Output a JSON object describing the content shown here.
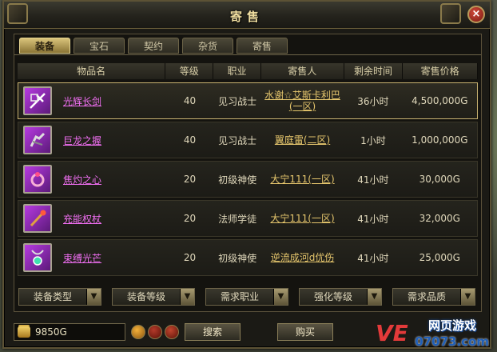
{
  "window": {
    "title": "寄售",
    "close_symbol": "×"
  },
  "tabs": [
    {
      "label": "装备",
      "active": true
    },
    {
      "label": "宝石",
      "active": false
    },
    {
      "label": "契约",
      "active": false
    },
    {
      "label": "杂货",
      "active": false
    },
    {
      "label": "寄售",
      "active": false
    }
  ],
  "table": {
    "columns": [
      "物品名",
      "等级",
      "职业",
      "寄售人",
      "剩余时间",
      "寄售价格"
    ],
    "rows": [
      {
        "icon": "sword-icon",
        "name": "光辉长剑",
        "level": "40",
        "job": "见习战士",
        "seller": "水谢☆艾斯卡利巴(一区)",
        "time": "36小时",
        "price": "4,500,000G",
        "selected": true
      },
      {
        "icon": "gauntlet-icon",
        "name": "巨龙之握",
        "level": "40",
        "job": "见习战士",
        "seller": "翼庭雷(二区)",
        "time": "1小时",
        "price": "1,000,000G",
        "selected": false
      },
      {
        "icon": "ring-icon",
        "name": "焦灼之心",
        "level": "20",
        "job": "初级神使",
        "seller": "大宁111(一区)",
        "time": "41小时",
        "price": "30,000G",
        "selected": false
      },
      {
        "icon": "staff-icon",
        "name": "充能权杖",
        "level": "20",
        "job": "法师学徒",
        "seller": "大宁111(一区)",
        "time": "41小时",
        "price": "32,000G",
        "selected": false
      },
      {
        "icon": "amulet-icon",
        "name": "束缚光芒",
        "level": "20",
        "job": "初级神使",
        "seller": "逆流成河d优伤",
        "time": "41小时",
        "price": "25,000G",
        "selected": false
      }
    ]
  },
  "filters": [
    "装备类型",
    "装备等级",
    "需求职业",
    "强化等级",
    "需求品质"
  ],
  "footer": {
    "gold": "9850G",
    "search_label": "搜索",
    "buy_label": "购买"
  },
  "watermark": {
    "line1": "网页游戏",
    "line2": "07073.com",
    "logo": "VE"
  },
  "colors": {
    "item_name": "#ee6ef0",
    "seller": "#e4c56c",
    "active_tab": "#d9c37a"
  }
}
